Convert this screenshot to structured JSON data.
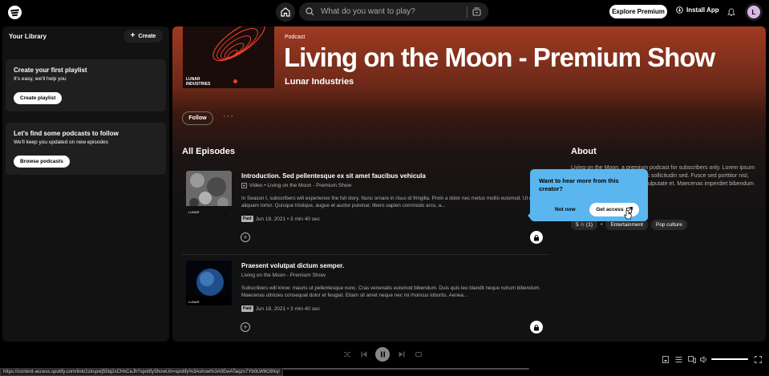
{
  "topbar": {
    "search_placeholder": "What do you want to play?",
    "explore_premium": "Explore Premium",
    "install_app": "Install App",
    "avatar_initial": "L"
  },
  "library": {
    "title": "Your Library",
    "create": "Create",
    "cards": [
      {
        "title": "Create your first playlist",
        "subtitle": "It's easy, we'll help you",
        "button": "Create playlist"
      },
      {
        "title": "Let's find some podcasts to follow",
        "subtitle": "We'll keep you updated on new episodes",
        "button": "Browse podcasts"
      }
    ]
  },
  "show": {
    "type": "Podcast",
    "title": "Living on the Moon - Premium Show",
    "author": "Lunar Industries",
    "cover_label": "LUNAR\nINDUSTRIES",
    "follow": "Follow",
    "more": "···"
  },
  "episodes_heading": "All Episodes",
  "episodes": [
    {
      "title": "Introduction. Sed pellentesque ex sit amet faucibus vehicula",
      "show_line": "Video • Living on the Moon - Premium Show",
      "description": "In Season I, subscribers will experience the full story. Nunc ornare in risus id fringilla. Proin a dolor nec metus mollis euismod. Ut non aliquam tortor. Quisque tristique, augue et auctor pulvinar, libero sapien commodo arcu, a...",
      "badge": "Paid",
      "meta": "Jun 18, 2021 • 3 min 40 sec"
    },
    {
      "title": "Praesent volutpat dictum semper.",
      "show_line": "Living on the Moon - Premium Show",
      "description": "Subscribers will know: mauris ut pellentesque nunc. Cras venenatis euismod bibendum. Duis quis leo blandit neque rutrum bibendum. Maecenas ultricies consequat dolor et feugiat. Etiam sit amet neque nec mi rhoncus lobortis. Aenea...",
      "badge": "Paid",
      "meta": "Jun 18, 2021 • 3 min 40 sec"
    }
  ],
  "about": {
    "heading": "About",
    "text": "Living on the Moon, a premium podcast for subscribers only. Lorem ipsum dolor sit amet, accumsan lectus sollicitudin sed. Fusce sed porttitor nisl, dictum metus, vel varius nibh vulputate et. Maecenas imperdiet bibendum",
    "rating": "5 ☆ (1)",
    "tags": [
      "Entertainment",
      "Pop culture"
    ]
  },
  "popover": {
    "question": "Want to hear more from this creator?",
    "not_now": "Not now",
    "get_access": "Get access"
  },
  "status_url": "https://content-access.spotify.com/link/2zkspolj55bj2sCHxCeJh?spotifyShowUri=spotify%3Ashow%3A0EwATaqzn7Yb0LW6O9Xq!",
  "colors": {
    "accent_blue": "#5bb6f0",
    "hero_red": "#a03a22",
    "background": "#121212"
  }
}
